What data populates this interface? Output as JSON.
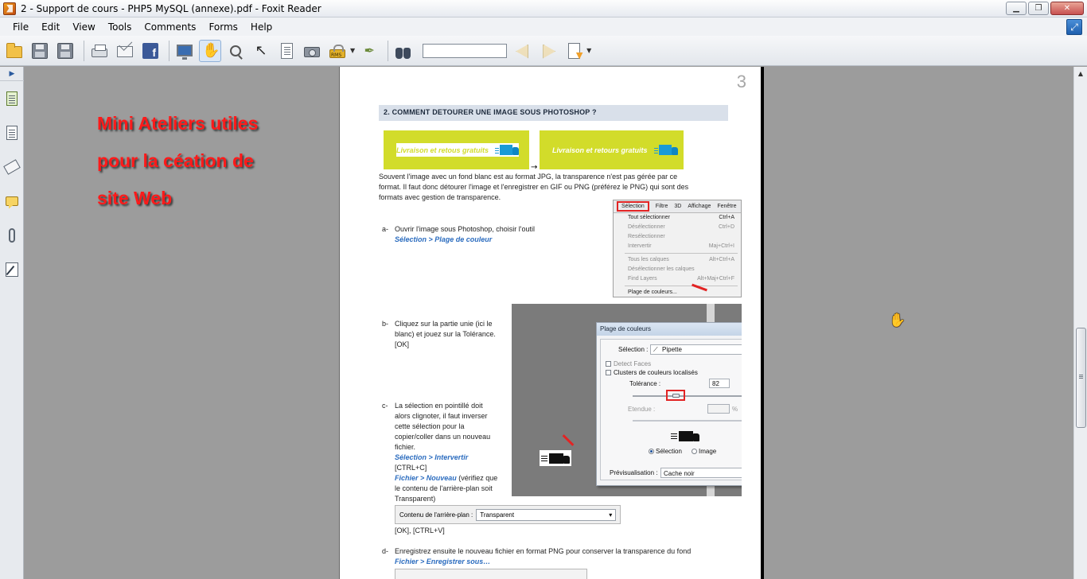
{
  "window": {
    "title": "2 - Support de cours - PHP5 MySQL (annexe).pdf - Foxit Reader",
    "minimize": "▁",
    "maximize": "❐",
    "close": "✕"
  },
  "menubar": {
    "items": [
      "File",
      "Edit",
      "View",
      "Tools",
      "Comments",
      "Forms",
      "Help"
    ]
  },
  "toolbar": {
    "search_value": "",
    "icons": [
      "open-folder",
      "save",
      "save-all",
      "print",
      "email",
      "facebook",
      "full-screen",
      "hand-tool",
      "zoom-tool",
      "select-tool",
      "text-select",
      "snapshot",
      "rms-protect",
      "sign",
      "find",
      "find-prev",
      "find-next",
      "find-options"
    ],
    "rms_label": "RMS"
  },
  "overlay": {
    "line1": "Mini Ateliers utiles",
    "line2": "pour la céation de",
    "line3": "site Web"
  },
  "page": {
    "number": "3",
    "section_title": "2.   COMMENT DETOURER UNE IMAGE SOUS PHOTOSHOP ?",
    "banner_text": "Livraison et retous gratuits",
    "banner_text2": "Livraison et retours gratuits",
    "arrow": "→",
    "intro_line1": "Souvent l'image avec un fond blanc est au format JPG, la transparence n'est pas gérée par ce",
    "intro_line2": "format. Il faut donc détourer l'image et l'enregistrer en GIF ou PNG (préférez le PNG) qui sont des",
    "intro_line3": "formats avec gestion de transparence.",
    "step_a_label": "a-",
    "step_a_text": "Ouvrir l'image sous Photoshop, choisir l'outil",
    "step_a_path": "Sélection > Plage de couleur",
    "step_b_label": "b-",
    "step_b_line1": "Cliquez sur la partie unie (ici le",
    "step_b_line2": "blanc) et jouez sur la Tolérance.",
    "step_b_line3": "[OK]",
    "step_c_label": "c-",
    "step_c_line1": "La sélection en pointillé doit",
    "step_c_line2": "alors clignoter, il faut inverser",
    "step_c_line3": "cette sélection pour la",
    "step_c_line4": "copier/coller dans un nouveau",
    "step_c_line5": "fichier.",
    "step_c_path1": "Sélection > Intervertir",
    "step_c_ctrl": "[CTRL+C]",
    "step_c_path2": "Fichier > Nouveau",
    "step_c_note1": " (vérifiez que",
    "step_c_note2": "le contenu de l'arrière-plan soit",
    "step_c_note3": "Transparent)",
    "bg_label": "Contenu de l'arrière-plan :",
    "bg_value": "Transparent",
    "ok_ctrlv": "[OK], [CTRL+V]",
    "step_d_label": "d-",
    "step_d_text": "Enregistrez ensuite le nouveau fichier en format PNG pour conserver la transparence du fond",
    "step_d_path": "Fichier > Enregistrer sous…"
  },
  "menu_shot": {
    "bar": [
      "Sélection",
      "Filtre",
      "3D",
      "Affichage",
      "Fenêtre"
    ],
    "items": [
      {
        "label": "Tout sélectionner",
        "shortcut": "Ctrl+A",
        "dim": false
      },
      {
        "label": "Désélectionner",
        "shortcut": "Ctrl+D",
        "dim": true
      },
      {
        "label": "Resélectionner",
        "shortcut": "",
        "dim": true
      },
      {
        "label": "Intervertir",
        "shortcut": "Maj+Ctrl+I",
        "dim": true
      },
      {
        "label": "Tous les calques",
        "shortcut": "Alt+Ctrl+A",
        "dim": true
      },
      {
        "label": "Désélectionner les calques",
        "shortcut": "",
        "dim": true
      },
      {
        "label": "Find Layers",
        "shortcut": "Alt+Maj+Ctrl+F",
        "dim": true
      },
      {
        "label": "Plage de couleurs...",
        "shortcut": "",
        "dim": false
      }
    ]
  },
  "dialog_shot": {
    "title": "Plage de couleurs",
    "selection_label": "Sélection :",
    "selection_value": "Pipette",
    "detect_faces": "Detect Faces",
    "clusters": "Clusters de couleurs localisés",
    "tolerance_label": "Tolérance :",
    "tolerance_value": "82",
    "etendue_label": "Etendue :",
    "etendue_unit": "%",
    "radio_selection": "Sélection",
    "radio_image": "Image",
    "preview_label": "Prévisualisation :",
    "preview_value": "Cache noir"
  },
  "colors": {
    "accent_red": "#ff1a1a",
    "banner_yellow": "#d2dc2a",
    "link_blue": "#2b6cbf"
  }
}
